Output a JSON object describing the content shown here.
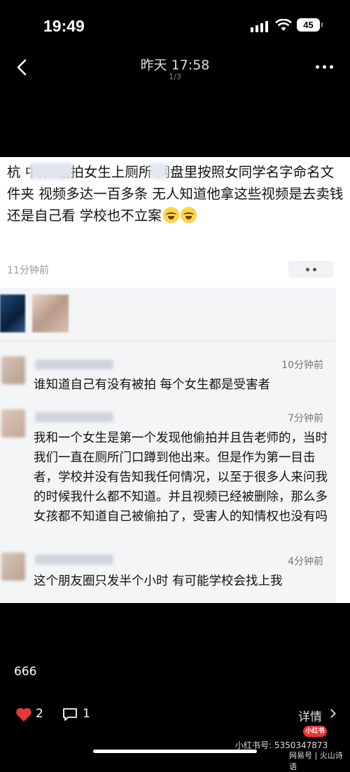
{
  "status_bar": {
    "time": "19:49",
    "battery": "45"
  },
  "top_bar": {
    "title": "昨天 17:58",
    "pager": "1/3"
  },
  "post": {
    "text": "杭 中朱 偷拍女生上厕所 网盘里按照女同学名字命名文件夹 视频多达一百多条 无人知道他拿这些视频是去卖钱还是自己看 学校也不立案",
    "emojis": [
      "crying-laughing-emoji",
      "crying-laughing-emoji"
    ],
    "time_ago": "11分钟前"
  },
  "comments": [
    {
      "time": "10分钟前",
      "text": "谁知道自己有没有被拍 每个女生都是受害者"
    },
    {
      "time": "7分钟前",
      "text": "我和一个女生是第一个发现他偷拍并且告老师的，当时我们一直在厕所门口蹲到他出来。但是作为第一目击者，学校并没有告知我任何情况，以至于很多人来问我的时候我什么都不知道。并且视频已经被删除，那么多女孩都不知道自己被偷拍了，受害人的知情权也没有吗"
    },
    {
      "time": "4分钟前",
      "text": "这个朋友圈只发半个小时 有可能学校会找上我"
    }
  ],
  "footer": {
    "view_count": "666",
    "likes": "2",
    "comments": "1",
    "detail_label": "详情",
    "watermark_logo": "小红书",
    "watermark_line1": "小红书号: 5350347873",
    "watermark_line2": "网易号 | 火山诗语"
  },
  "colors": {
    "background": "#000000",
    "like": "#e53935"
  }
}
